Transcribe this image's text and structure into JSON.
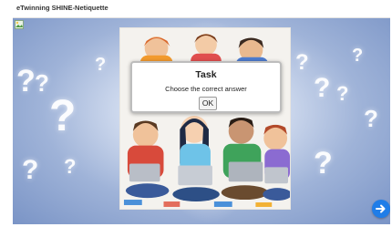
{
  "app": {
    "title": "eTwinning SHINE-Netiquette"
  },
  "dialog": {
    "title": "Task",
    "message": "Choose the correct answer",
    "ok_label": "OK"
  },
  "icons": {
    "corner": "image-icon",
    "next": "arrow-right-icon"
  },
  "colors": {
    "accent": "#1f7de8",
    "background": "#9fb3d8"
  }
}
